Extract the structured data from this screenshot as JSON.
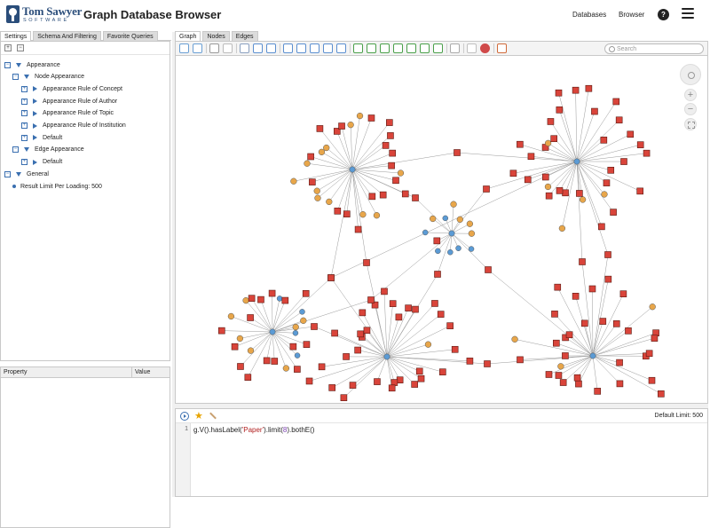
{
  "header": {
    "logo_text": "Tom Sawyer",
    "logo_sub": "SOFTWARE",
    "title": "Graph Database Browser",
    "nav": [
      "Databases",
      "Browser"
    ],
    "help_label": "?"
  },
  "left_tabs": [
    "Settings",
    "Schema And Filtering",
    "Favorite Queries"
  ],
  "tree": {
    "toolbar": [
      "+",
      "−"
    ],
    "items": [
      {
        "label": "Appearance",
        "level": 0,
        "kind": "expand"
      },
      {
        "label": "Node Appearance",
        "level": 1,
        "kind": "expand"
      },
      {
        "label": "Appearance Rule of Concept",
        "level": 2,
        "kind": "leaf"
      },
      {
        "label": "Appearance Rule of Author",
        "level": 2,
        "kind": "leaf"
      },
      {
        "label": "Appearance Rule of Topic",
        "level": 2,
        "kind": "leaf"
      },
      {
        "label": "Appearance Rule of Institution",
        "level": 2,
        "kind": "leaf"
      },
      {
        "label": "Default",
        "level": 2,
        "kind": "leaf"
      },
      {
        "label": "Edge Appearance",
        "level": 1,
        "kind": "expand"
      },
      {
        "label": "Default",
        "level": 2,
        "kind": "leaf"
      },
      {
        "label": "General",
        "level": 0,
        "kind": "expand"
      },
      {
        "label": "Result Limit Per Loading: 500",
        "level": 1,
        "kind": "bullet"
      }
    ]
  },
  "properties": {
    "columns": [
      "Property",
      "Value"
    ]
  },
  "graph_tabs": [
    "Graph",
    "Nodes",
    "Edges"
  ],
  "search": {
    "placeholder": "Search"
  },
  "query": {
    "default_limit": "Default Limit: 500",
    "line_number": "1",
    "code_prefix": "g.V().hasLabel(",
    "code_string": "'Paper'",
    "code_mid": ").limit(",
    "code_number": "8",
    "code_suffix": ").bothE()"
  },
  "colors": {
    "accent": "#3a6fb0",
    "paper_node": "#d9443a",
    "concept_node": "#e8a64a",
    "hub_node": "#5b9bd5",
    "edge": "#9a9a9a"
  }
}
